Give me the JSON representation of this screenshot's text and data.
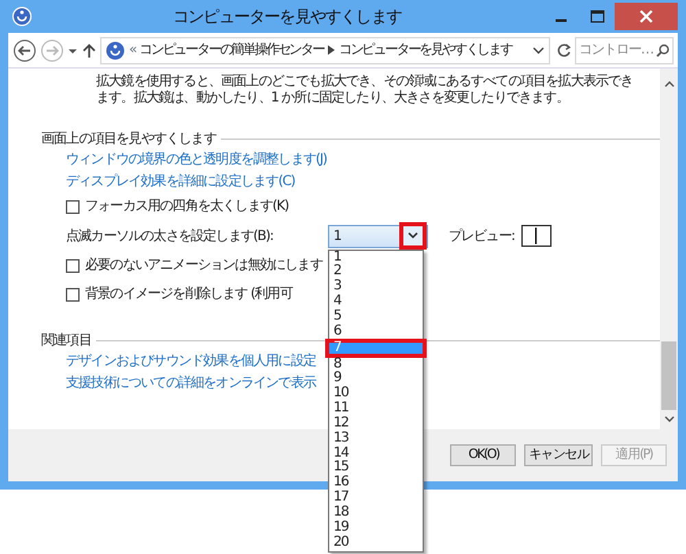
{
  "window": {
    "title": "コンピューターを見やすくします"
  },
  "address_bar": {
    "prefix": "«",
    "crumbs": [
      "コンピューターの簡単操作センター",
      "コンピューターを見やすくします"
    ],
    "search": {
      "placeholder": "コントロー…"
    }
  },
  "intro": "拡大鏡を使用すると、画面上のどこでも拡大でき、その領域にあるすべての項目を拡大表示できます。拡大鏡は、動かしたり、1 か所に固定したり、大きさを変更したりできます。",
  "sections": [
    {
      "heading": "画面上の項目を見やすくします",
      "items": [
        {
          "kind": "link",
          "text": "ウィンドウの境界の色と透明度を調整します(J)"
        },
        {
          "kind": "link",
          "text": "ディスプレイ効果を詳細に設定します(C)"
        },
        {
          "kind": "checkbox",
          "text": "フォーカス用の四角を太くします(K)",
          "checked": false
        },
        {
          "kind": "combo",
          "text": "点滅カーソルの太さを設定します(B):",
          "value": "1",
          "arrow_highlighted": true,
          "preview_label": "プレビュー:"
        },
        {
          "kind": "checkbox",
          "text": "必要のないアニメーションは無効にします",
          "checked": false
        },
        {
          "kind": "checkbox",
          "text": "背景のイメージを削除します (利用可",
          "checked": false
        }
      ]
    },
    {
      "heading": "関連項目",
      "items": [
        {
          "kind": "link",
          "text": "デザインおよびサウンド効果を個人用に設定"
        },
        {
          "kind": "link",
          "text": "支援技術についての詳細をオンラインで表示"
        }
      ]
    }
  ],
  "dropdown": {
    "options": [
      {
        "text": "1",
        "selected": false,
        "highlighted": false
      },
      {
        "text": "2",
        "selected": false,
        "highlighted": false
      },
      {
        "text": "3",
        "selected": false,
        "highlighted": false
      },
      {
        "text": "4",
        "selected": false,
        "highlighted": false
      },
      {
        "text": "5",
        "selected": false,
        "highlighted": false
      },
      {
        "text": "6",
        "selected": false,
        "highlighted": false
      },
      {
        "text": "7",
        "selected": true,
        "highlighted": true
      },
      {
        "text": "8",
        "selected": false,
        "highlighted": false
      },
      {
        "text": "9",
        "selected": false,
        "highlighted": false
      },
      {
        "text": "10",
        "selected": false,
        "highlighted": false
      },
      {
        "text": "11",
        "selected": false,
        "highlighted": false
      },
      {
        "text": "12",
        "selected": false,
        "highlighted": false
      },
      {
        "text": "13",
        "selected": false,
        "highlighted": false
      },
      {
        "text": "14",
        "selected": false,
        "highlighted": false
      },
      {
        "text": "15",
        "selected": false,
        "highlighted": false
      },
      {
        "text": "16",
        "selected": false,
        "highlighted": false
      },
      {
        "text": "17",
        "selected": false,
        "highlighted": false
      },
      {
        "text": "18",
        "selected": false,
        "highlighted": false
      },
      {
        "text": "19",
        "selected": false,
        "highlighted": false
      },
      {
        "text": "20",
        "selected": false,
        "highlighted": false
      }
    ]
  },
  "buttons": [
    {
      "label": "OK(O)",
      "disabled": false
    },
    {
      "label": "キャンセル",
      "disabled": false
    },
    {
      "label": "適用(P)",
      "disabled": true
    }
  ]
}
